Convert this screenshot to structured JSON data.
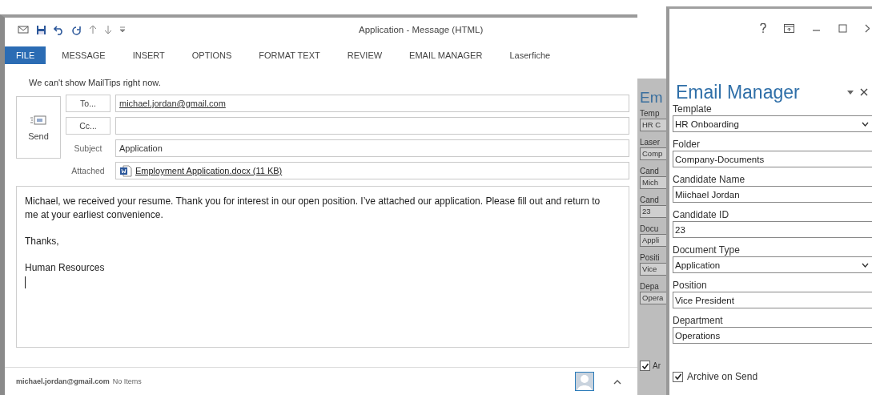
{
  "message_window": {
    "title": "Application - Message (HTML)",
    "tabs": [
      {
        "label": "FILE",
        "selected": true
      },
      {
        "label": "MESSAGE",
        "selected": false
      },
      {
        "label": "INSERT",
        "selected": false
      },
      {
        "label": "OPTIONS",
        "selected": false
      },
      {
        "label": "FORMAT TEXT",
        "selected": false
      },
      {
        "label": "REVIEW",
        "selected": false
      },
      {
        "label": "EMAIL MANAGER",
        "selected": false
      },
      {
        "label": "Laserfiche",
        "selected": false
      }
    ],
    "mailtips": "We can't show MailTips right now.",
    "send_button": "Send",
    "to": {
      "button": "To...",
      "value": "michael.jordan@gmail.com"
    },
    "cc": {
      "button": "Cc..."
    },
    "subject": {
      "label": "Subject",
      "value": "Application"
    },
    "attached": {
      "label": "Attached",
      "file": "Employment Application.docx (11 KB)"
    },
    "body": [
      "Michael, we received your resume. Thank you for interest in our open position. I’ve attached our application. Please fill out and return to me at your earliest convenience.",
      "Thanks,",
      "Human Resources"
    ],
    "status_bar": {
      "account": "michael.jordan@gmail.com",
      "items": "No Items"
    }
  },
  "back_panel": {
    "title": "Em",
    "fields": [
      {
        "label": "Temp",
        "value": "HR C"
      },
      {
        "label": "Laser",
        "value": "Comp"
      },
      {
        "label": "Cand",
        "value": "Mich"
      },
      {
        "label": "Cand",
        "value": "23"
      },
      {
        "label": "Docu",
        "value": "Appli"
      },
      {
        "label": "Positi",
        "value": "Vice"
      },
      {
        "label": "Depa",
        "value": "Opera"
      }
    ],
    "archive": {
      "label": "Ar",
      "checked": true
    }
  },
  "email_manager": {
    "title": "Email Manager",
    "fields": [
      {
        "label": "Template",
        "value": "HR Onboarding",
        "kind": "dropdown"
      },
      {
        "label": "Folder",
        "value": "Company-Documents",
        "kind": "text"
      },
      {
        "label": "Candidate Name",
        "value": "Miichael Jordan",
        "kind": "text"
      },
      {
        "label": "Candidate ID",
        "value": "23",
        "kind": "text"
      },
      {
        "label": "Document Type",
        "value": "Application",
        "kind": "dropdown"
      },
      {
        "label": "Position",
        "value": "Vice President",
        "kind": "text"
      },
      {
        "label": "Department",
        "value": "Operations",
        "kind": "text"
      }
    ],
    "archive": {
      "label": "Archive on Send",
      "checked": true
    }
  }
}
